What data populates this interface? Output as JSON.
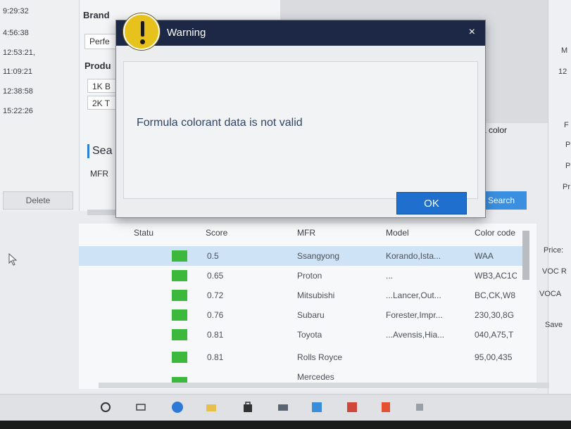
{
  "timestamps": [
    "9:29:32",
    "4:56:38",
    "12:53:21,",
    "11:09:21",
    "12:38:58",
    "15:22:26"
  ],
  "left_panel": {
    "delete_label": "Delete"
  },
  "filter_panel": {
    "brand_label": "Brand",
    "brand_value": "Perfe",
    "product_label": "Produ",
    "product_options": [
      "1K B",
      "2K T"
    ],
    "search_label": "Sea",
    "mfr_label": "MFR"
  },
  "color_label": "a color",
  "search_button": "Search",
  "right_panel": {
    "items": [
      "M",
      "12",
      "F",
      "P",
      "P",
      "Pr"
    ],
    "price_label": "Price:",
    "voc_r": "VOC R",
    "voc_a": "VOCA",
    "save": "Save"
  },
  "table": {
    "headers": [
      "Statu",
      "Score",
      "MFR",
      "Model",
      "Color code"
    ],
    "rows": [
      {
        "score": "0.5",
        "mfr": "Ssangyong",
        "model": "Korando,Ista...",
        "color": "WAA"
      },
      {
        "score": "0.65",
        "mfr": "Proton",
        "model": "...",
        "color": "WB3,AC1C"
      },
      {
        "score": "0.72",
        "mfr": "Mitsubishi",
        "model": "...Lancer,Out...",
        "color": "BC,CK,W8"
      },
      {
        "score": "0.76",
        "mfr": "Subaru",
        "model": "Forester,Impr...",
        "color": "230,30,8G"
      },
      {
        "score": "0.81",
        "mfr": "Toyota",
        "model": "...Avensis,Hia...",
        "color": "040,A75,T"
      },
      {
        "score": "0.81",
        "mfr": "Rolls Royce",
        "model": "",
        "color": "95,00,435"
      },
      {
        "score": "",
        "mfr": "Mercedes",
        "model": "",
        "color": ""
      }
    ]
  },
  "dialog": {
    "title": "Warning",
    "close_glyph": "×",
    "message": "Formula colorant data is not valid",
    "ok_label": "OK"
  },
  "colors": {
    "titlebar": "#1d2847",
    "ok_button": "#1f6fcf",
    "status_green": "#3cb83c",
    "warning_yellow": "#e8c21c"
  }
}
